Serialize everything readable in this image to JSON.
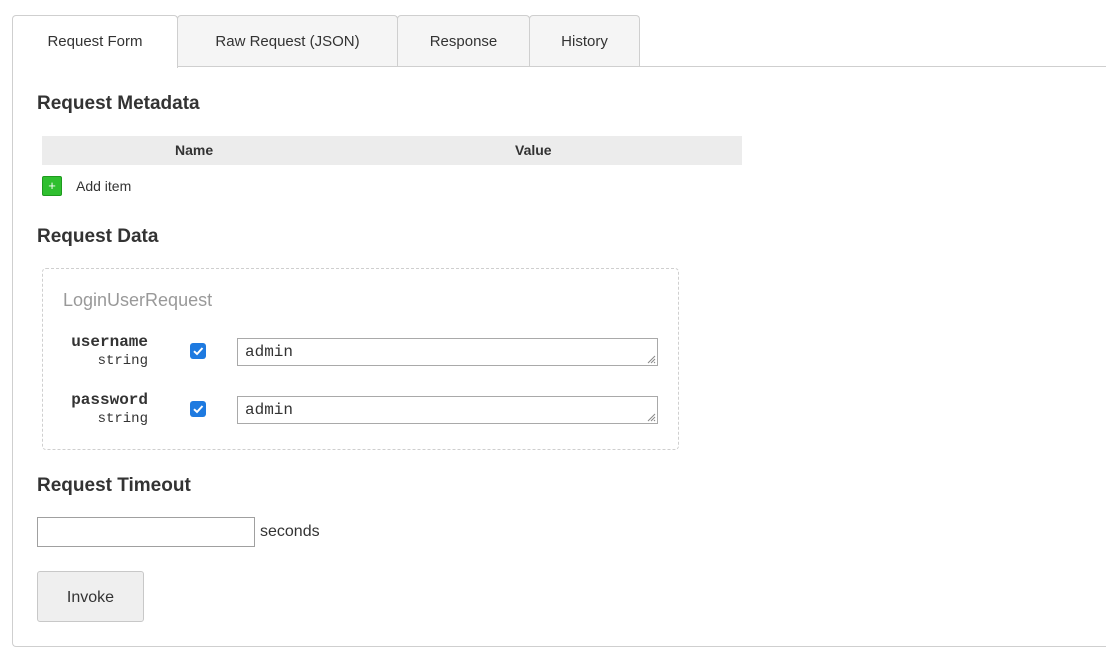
{
  "tabs": [
    {
      "label": "Request Form",
      "active": true
    },
    {
      "label": "Raw Request (JSON)",
      "active": false
    },
    {
      "label": "Response",
      "active": false
    },
    {
      "label": "History",
      "active": false
    }
  ],
  "metadata": {
    "heading": "Request Metadata",
    "columns": [
      "Name",
      "Value"
    ],
    "add_label": "Add item",
    "add_icon": "plus-icon"
  },
  "request_data": {
    "heading": "Request Data",
    "message_name": "LoginUserRequest",
    "fields": [
      {
        "name": "username",
        "type": "string",
        "included": true,
        "value": "admin"
      },
      {
        "name": "password",
        "type": "string",
        "included": true,
        "value": "admin"
      }
    ]
  },
  "timeout": {
    "heading": "Request Timeout",
    "value": "",
    "unit": "seconds"
  },
  "invoke_label": "Invoke",
  "colors": {
    "checkbox": "#1e7ae0",
    "add_button": "#2fbf2f",
    "table_header": "#ececec"
  }
}
